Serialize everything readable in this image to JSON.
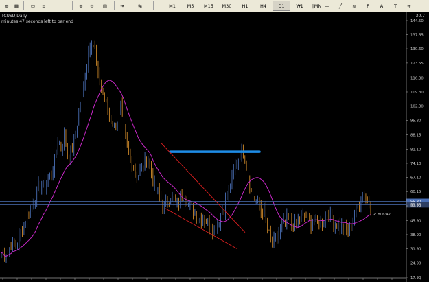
{
  "toolbar": {
    "timeframes": [
      "M1",
      "M5",
      "M15",
      "M30",
      "H1",
      "H4",
      "D1",
      "W1",
      "MN"
    ],
    "active_timeframe": "D1",
    "icons": [
      "new-order-icon",
      "profiles-icon",
      "open-folder-icon",
      "market-watch-icon",
      "zoom-in-icon",
      "zoom-out-icon",
      "tile-icon",
      "scroll-icon",
      "shift-icon",
      "cursor-icon",
      "crosshair-icon",
      "vertical-line-icon",
      "horizontal-line-icon",
      "trendline-icon",
      "channel-icon",
      "fibonacci-icon",
      "text-icon",
      "label-icon",
      "arrow-icon"
    ]
  },
  "chart": {
    "title": "TCUSD,Daily",
    "countdown": "minutes 47 seconds left to bar end",
    "top_right_value": "30.7",
    "bar_timer": "< 806:47",
    "colors": {
      "background": "#000000",
      "bull_candle": "#4a6fb5",
      "bear_candle": "#d08a2a",
      "moving_average": "#c828c8",
      "horizontal_line": "#1e8ce6",
      "channel_lines": "#e02020",
      "price_lines": "#4a6fb5"
    }
  },
  "chart_data": {
    "type": "candlestick",
    "y_axis_ticks": [
      "144.50",
      "137.55",
      "130.60",
      "123.55",
      "116.30",
      "109.30",
      "102.30",
      "95.30",
      "88.15",
      "81.10",
      "74.10",
      "67.10",
      "60.15",
      "53.10",
      "45.90",
      "38.90",
      "31.90",
      "24.90",
      "17.90"
    ],
    "ylim": [
      17.9,
      144.5
    ],
    "current_price_label": "55.30",
    "secondary_price_label": "53.65",
    "annotations": {
      "horizontal_line_price": 79.8,
      "falling_channel": true
    },
    "close_series": [
      30,
      28,
      31,
      34,
      33,
      36,
      40,
      46,
      49,
      53,
      57,
      61,
      64,
      62,
      66,
      70,
      74,
      86,
      82,
      88,
      76,
      80,
      85,
      97,
      105,
      115,
      128,
      136,
      131,
      117,
      112,
      106,
      100,
      96,
      92,
      96,
      102,
      87,
      80,
      76,
      71,
      68,
      71,
      74,
      78,
      70,
      62,
      59,
      55,
      53,
      56,
      58,
      55,
      54,
      57,
      59,
      55,
      52,
      50,
      48,
      47,
      46,
      45,
      43,
      42,
      44,
      49,
      53,
      59,
      64,
      71,
      76,
      80,
      79,
      70,
      60,
      57,
      55,
      51,
      50,
      41,
      36,
      35,
      38,
      42,
      44,
      46,
      45,
      43,
      45,
      47,
      48,
      47,
      45,
      46,
      44,
      45,
      47,
      49,
      47,
      45,
      44,
      43,
      42,
      41,
      43,
      48,
      52,
      57,
      58,
      55,
      53
    ]
  }
}
